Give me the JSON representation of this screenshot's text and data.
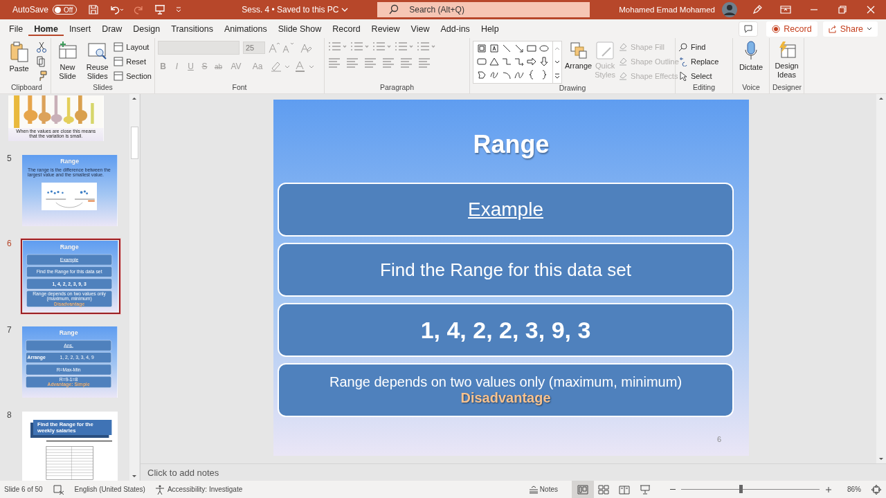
{
  "title_bar": {
    "autosave": {
      "label": "AutoSave",
      "toggle": "Off",
      "on": false
    },
    "document": "Sess. 4 • Saved to this PC",
    "search": {
      "placeholder": "Search (Alt+Q)"
    },
    "user": "Mohamed Emad Mohamed"
  },
  "tabs": [
    {
      "label": "File",
      "selected": false
    },
    {
      "label": "Home",
      "selected": true
    },
    {
      "label": "Insert",
      "selected": false
    },
    {
      "label": "Draw",
      "selected": false
    },
    {
      "label": "Design",
      "selected": false
    },
    {
      "label": "Transitions",
      "selected": false
    },
    {
      "label": "Animations",
      "selected": false
    },
    {
      "label": "Slide Show",
      "selected": false
    },
    {
      "label": "Record",
      "selected": false
    },
    {
      "label": "Review",
      "selected": false
    },
    {
      "label": "View",
      "selected": false
    },
    {
      "label": "Add-ins",
      "selected": false
    },
    {
      "label": "Help",
      "selected": false
    }
  ],
  "actions": {
    "record": "Record",
    "share": "Share"
  },
  "ribbon": {
    "clipboard": {
      "label": "Clipboard",
      "paste": "Paste"
    },
    "slides": {
      "label": "Slides",
      "new_slide": "New Slide",
      "reuse_slides": "Reuse Slides",
      "small": [
        "Layout",
        "Reset",
        "Section"
      ]
    },
    "font": {
      "label": "Font",
      "disabled": true,
      "size": "25",
      "buttons": [
        "B",
        "I",
        "U",
        "S",
        "ab",
        "AV",
        "Aa"
      ]
    },
    "paragraph": {
      "label": "Paragraph"
    },
    "drawing": {
      "label": "Drawing",
      "arrange": "Arrange",
      "quick_styles": {
        "label": "Quick Styles",
        "disabled": true
      },
      "shape_options": [
        {
          "label": "Shape Fill",
          "disabled": true
        },
        {
          "label": "Shape Outline",
          "disabled": true
        },
        {
          "label": "Shape Effects",
          "disabled": true
        }
      ]
    },
    "editing": {
      "label": "Editing",
      "items": [
        {
          "kind": "find",
          "label": "Find"
        },
        {
          "kind": "replace",
          "label": "Replace"
        },
        {
          "kind": "select",
          "label": "Select"
        }
      ]
    },
    "voice": {
      "label": "Voice",
      "dictate": "Dictate"
    },
    "designer": {
      "label": "Designer",
      "design_ideas": "Design Ideas"
    }
  },
  "thumbnails": [
    {
      "kind": "giraffes",
      "selected": false,
      "caption": "When the values are close this means that the variation is small."
    },
    {
      "kind": "definition",
      "number": "5",
      "selected": false,
      "title": "Range",
      "text": "The range is the difference between the largest value and the smallest value."
    },
    {
      "kind": "boxes",
      "number": "6",
      "selected": true,
      "title": "Range",
      "boxes": [
        {
          "kind": "link",
          "text": "Example"
        },
        {
          "kind": "text",
          "text": "Find the Range for this data set"
        },
        {
          "kind": "numbers",
          "text": "1, 4, 2, 2, 3, 9, 3"
        },
        {
          "kind": "note",
          "text": "Range depends on two values only (maximum, minimum)",
          "highlight": "Disadvantage"
        }
      ]
    },
    {
      "kind": "boxes",
      "number": "7",
      "selected": false,
      "title": "Range",
      "boxes": [
        {
          "kind": "link",
          "text": "Ans."
        },
        {
          "kind": "pair",
          "label": "Arrange",
          "text": "1, 2, 2, 3, 3, 4, 9"
        },
        {
          "kind": "text",
          "text": "R=Max-Min"
        },
        {
          "kind": "note",
          "text": "R=9-1=8",
          "highlight": "Advantage: Simple"
        }
      ]
    },
    {
      "kind": "table",
      "number": "8",
      "selected": false,
      "title": "Find the Range for the weekly salaries"
    }
  ],
  "slide": {
    "title": "Range",
    "boxes": [
      {
        "kind": "link",
        "text": "Example"
      },
      {
        "kind": "text",
        "text": "Find the Range for this data set"
      },
      {
        "kind": "numbers",
        "text": "1, 4, 2, 2, 3, 9, 3"
      },
      {
        "kind": "note",
        "text": "Range depends on two values only (maximum, minimum)",
        "highlight": "Disadvantage"
      }
    ],
    "page": "6"
  },
  "notes": {
    "placeholder": "Click to add notes"
  },
  "status_bar": {
    "slide": "Slide 6 of 50",
    "language": "English (United States)",
    "accessibility": "Accessibility: Investigate",
    "notes": "Notes",
    "views": [
      {
        "kind": "normal",
        "selected": true
      },
      {
        "kind": "sorter",
        "selected": false
      },
      {
        "kind": "reading",
        "selected": false
      },
      {
        "kind": "show",
        "selected": false
      }
    ],
    "zoom": {
      "level": 0.43,
      "reading": "86%"
    }
  }
}
